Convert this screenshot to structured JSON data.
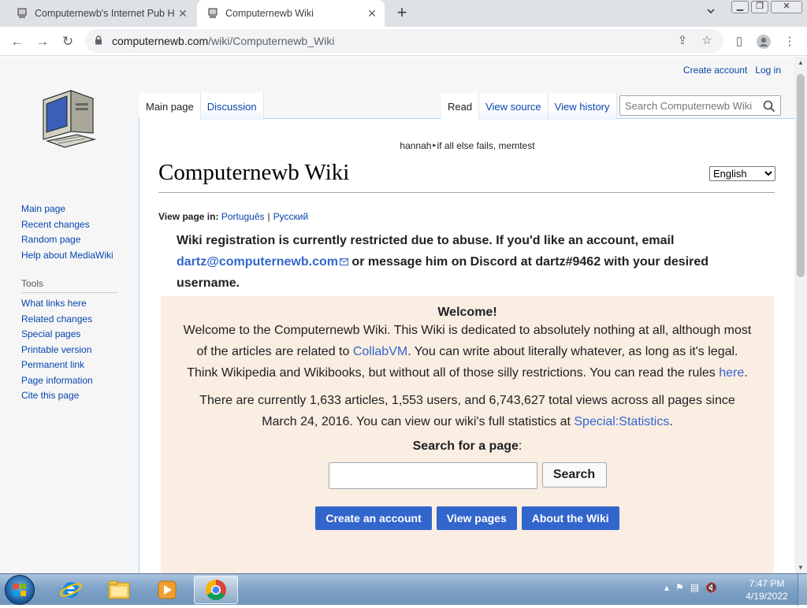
{
  "browser": {
    "tabs": [
      {
        "title": "Computernewb's Internet Pub H",
        "active": false
      },
      {
        "title": "Computernewb Wiki",
        "active": true
      }
    ],
    "url_domain": "computernewb.com",
    "url_path": "/wiki/Computernewb_Wiki"
  },
  "wiki": {
    "personal": {
      "create_account": "Create account",
      "log_in": "Log in"
    },
    "left_tabs": [
      "Main page",
      "Discussion"
    ],
    "right_tabs": [
      "Read",
      "View source",
      "View history"
    ],
    "search_placeholder": "Search Computernewb Wiki",
    "navigation": [
      "Main page",
      "Recent changes",
      "Random page",
      "Help about MediaWiki"
    ],
    "tools_heading": "Tools",
    "tools": [
      "What links here",
      "Related changes",
      "Special pages",
      "Printable version",
      "Permanent link",
      "Page information",
      "Cite this page"
    ],
    "site_notice": "hannah‣if all else fails, memtest",
    "title": "Computernewb Wiki",
    "language": "English",
    "view_page_in": {
      "label": "View page in:",
      "languages": [
        "Português",
        "Русский"
      ]
    },
    "notice": {
      "text1": "Wiki registration is currently restricted due to abuse. If you'd like an account, email ",
      "email": "dartz@computernewb.com",
      "text2": " or message him on Discord at dartz#9462 with your desired username."
    },
    "welcome": {
      "heading": "Welcome!",
      "p1_a": "Welcome to the Computernewb Wiki. This Wiki is dedicated to absolutely nothing at all, although most of the articles are related to ",
      "p1_link": "CollabVM",
      "p1_b": ". You can write about literally whatever, as long as it's legal. Think Wikipedia and Wikibooks, but without all of those silly restrictions. You can read the rules ",
      "p1_link2": "here",
      "p1_c": ".",
      "p2_a": "There are currently 1,633 articles, 1,553 users, and 6,743,627 total views across all pages since March 24, 2016. You can view our wiki's full statistics at ",
      "p2_link": "Special:Statistics",
      "p2_b": ".",
      "search_title": "Search for a page",
      "search_colon": ":",
      "search_button": "Search",
      "buttons": [
        "Create an account",
        "View pages",
        "About the Wiki"
      ]
    }
  },
  "taskbar": {
    "time": "7:47 PM",
    "date": "4/19/2022"
  }
}
